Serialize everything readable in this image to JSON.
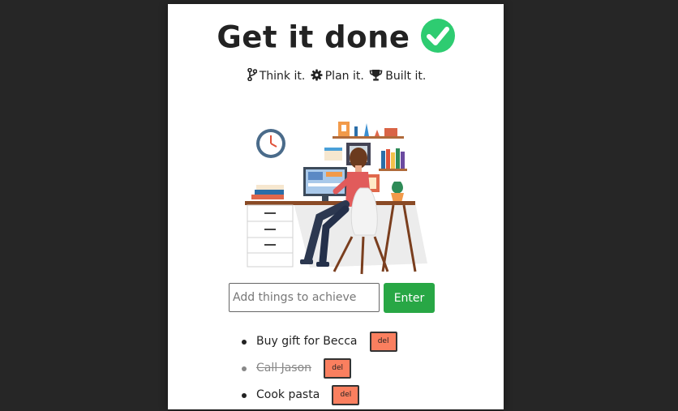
{
  "app": {
    "title": "Get it done",
    "tagline": {
      "think": "Think it.",
      "plan": "Plan it.",
      "built": "Built it."
    }
  },
  "icons": {
    "title_check": "check-circle-icon",
    "think": "code-branch-icon",
    "plan": "gear-icon",
    "built": "trophy-icon"
  },
  "form": {
    "input_value": "",
    "placeholder": "Add things to achieve",
    "enter_label": "Enter"
  },
  "todos": [
    {
      "text": "Buy gift for Becca",
      "done": false,
      "delete_label": "del"
    },
    {
      "text": "Call Jason",
      "done": true,
      "delete_label": "del"
    },
    {
      "text": "Cook pasta",
      "done": false,
      "delete_label": "del"
    }
  ],
  "colors": {
    "background": "#262626",
    "card": "#ffffff",
    "check": "#2ecc71",
    "enter_button": "#28a745",
    "delete_button": "#fa7f5f"
  }
}
